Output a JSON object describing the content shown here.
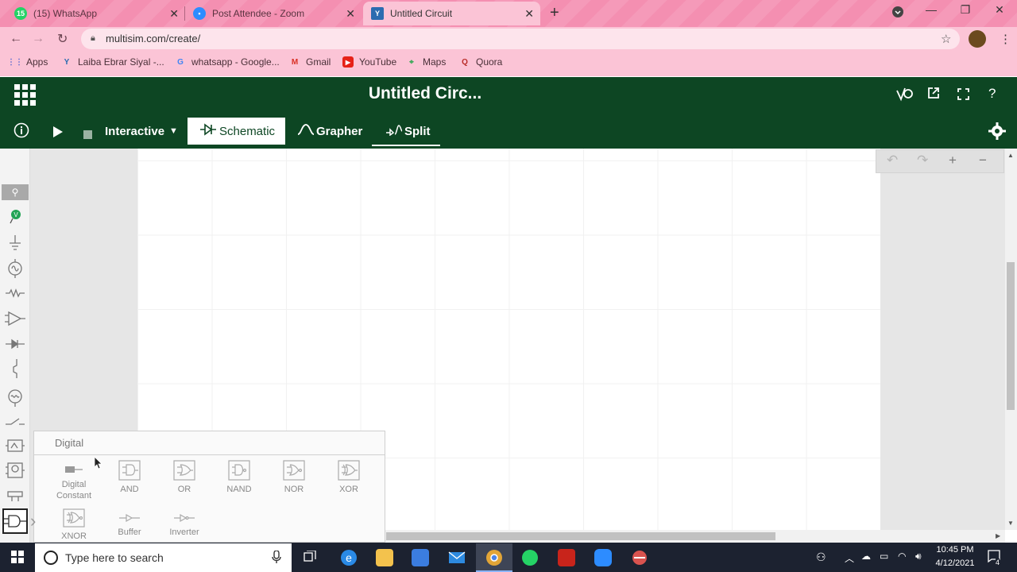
{
  "browser": {
    "tabs": [
      {
        "title": "(15) WhatsApp",
        "badge": "15",
        "color": "#25d366"
      },
      {
        "title": "Post Attendee - Zoom",
        "color": "#2d8cff"
      },
      {
        "title": "Untitled Circuit",
        "color": "#2b6cb0"
      }
    ],
    "url": "multisim.com/create/",
    "bookmarks": [
      "Apps",
      "Laiba Ebrar Siyal -...",
      "whatsapp - Google...",
      "Gmail",
      "YouTube",
      "Maps",
      "Quora"
    ]
  },
  "app": {
    "title": "Untitled Circ...",
    "sim_mode": "Interactive",
    "tabs": {
      "schematic": "Schematic",
      "grapher": "Grapher",
      "split": "Split"
    }
  },
  "popup": {
    "title": "Digital",
    "components": [
      {
        "label": "Digital Constant"
      },
      {
        "label": "AND"
      },
      {
        "label": "OR"
      },
      {
        "label": "NAND"
      },
      {
        "label": "NOR"
      },
      {
        "label": "XOR"
      },
      {
        "label": "XNOR"
      },
      {
        "label": "Buffer"
      },
      {
        "label": "Inverter"
      }
    ]
  },
  "taskbar": {
    "search_placeholder": "Type here to search",
    "time": "10:45 PM",
    "date": "4/12/2021",
    "notifications": "4"
  }
}
